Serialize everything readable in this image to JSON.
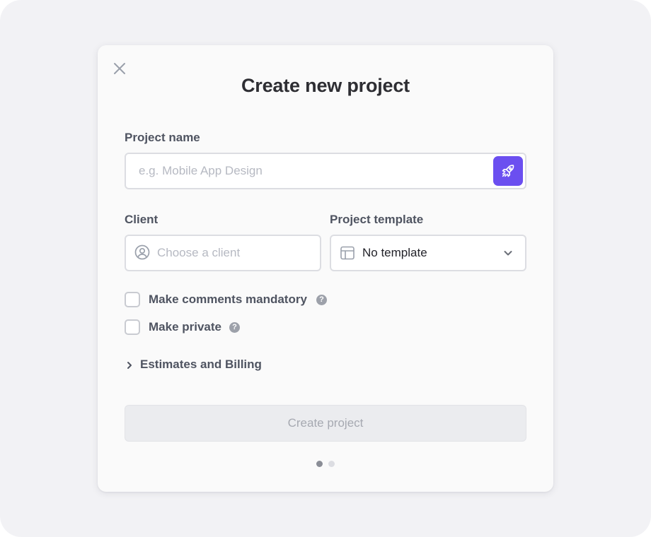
{
  "dialog": {
    "title": "Create new project",
    "close_icon": "close-icon"
  },
  "project_name": {
    "label": "Project name",
    "placeholder": "e.g. Mobile App Design",
    "value": "",
    "action_icon": "rocket-icon"
  },
  "client": {
    "label": "Client",
    "placeholder": "Choose a client",
    "value": "",
    "icon": "user-circle-icon"
  },
  "template": {
    "label": "Project template",
    "selected": "No template",
    "icon": "layout-template-icon",
    "dropdown_icon": "chevron-down-icon"
  },
  "options": [
    {
      "label": "Make comments mandatory",
      "checked": false,
      "help_icon": "question-icon"
    },
    {
      "label": "Make private",
      "checked": false,
      "help_icon": "question-icon"
    }
  ],
  "estimates": {
    "label": "Estimates and Billing",
    "expanded": false,
    "icon": "chevron-right-icon"
  },
  "submit": {
    "label": "Create project",
    "enabled": false
  },
  "pagination": {
    "current": 1,
    "total": 2
  },
  "colors": {
    "accent": "#6b4ff0",
    "backdrop": "#f2f2f5",
    "modal": "#fafafa",
    "dot_active": "#8a8d96",
    "dot_inactive": "#dcdde2"
  }
}
